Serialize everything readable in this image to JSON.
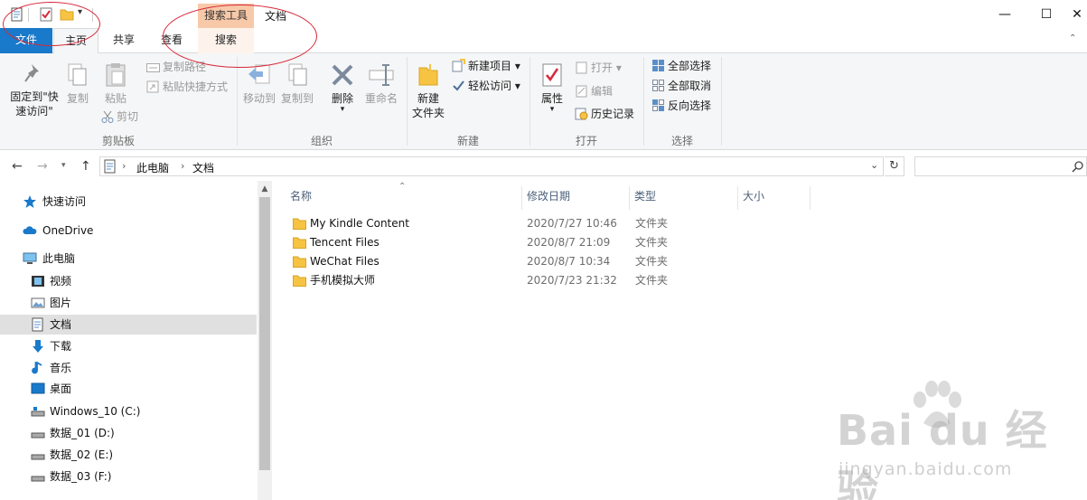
{
  "titlebar": {
    "context_tab_header": "搜索工具",
    "window_title": "文档",
    "quick_access_dropdown": "▾",
    "minimize": "—",
    "maximize": "☐",
    "close": "✕"
  },
  "tabs": {
    "file": "文件",
    "home": "主页",
    "share": "共享",
    "view": "查看",
    "search": "搜索"
  },
  "ribbon": {
    "clipboard": {
      "label": "剪贴板",
      "pin_line1": "固定到\"快",
      "pin_line2": "速访问\"",
      "copy": "复制",
      "paste": "粘贴",
      "copy_path": "复制路径",
      "paste_shortcut": "粘贴快捷方式",
      "cut": "剪切"
    },
    "organize": {
      "label": "组织",
      "move_to": "移动到",
      "copy_to": "复制到",
      "delete": "删除",
      "rename": "重命名"
    },
    "new": {
      "label": "新建",
      "new_folder_line1": "新建",
      "new_folder_line2": "文件夹",
      "new_item": "新建项目 ▾",
      "easy_access": "轻松访问 ▾"
    },
    "open": {
      "label": "打开",
      "properties": "属性",
      "open": "打开 ▾",
      "edit": "编辑",
      "history": "历史记录"
    },
    "select": {
      "label": "选择",
      "select_all": "全部选择",
      "select_none": "全部取消",
      "invert": "反向选择"
    }
  },
  "address": {
    "crumbs": [
      "此电脑",
      "文档"
    ],
    "search_placeholder": ""
  },
  "nav": {
    "items": [
      {
        "label": "快速访问",
        "icon": "star-icon"
      },
      {
        "label": "OneDrive",
        "icon": "cloud-icon"
      },
      {
        "label": "此电脑",
        "icon": "computer-icon"
      },
      {
        "label": "视频",
        "icon": "video-icon"
      },
      {
        "label": "图片",
        "icon": "picture-icon"
      },
      {
        "label": "文档",
        "icon": "document-icon"
      },
      {
        "label": "下载",
        "icon": "download-icon"
      },
      {
        "label": "音乐",
        "icon": "music-icon"
      },
      {
        "label": "桌面",
        "icon": "desktop-icon"
      },
      {
        "label": "Windows_10 (C:)",
        "icon": "system-drive-icon"
      },
      {
        "label": "数据_01 (D:)",
        "icon": "drive-icon"
      },
      {
        "label": "数据_02 (E:)",
        "icon": "drive-icon"
      },
      {
        "label": "数据_03 (F:)",
        "icon": "drive-icon"
      }
    ]
  },
  "files": {
    "columns": [
      "名称",
      "修改日期",
      "类型",
      "大小"
    ],
    "rows": [
      {
        "name": "My Kindle Content",
        "date": "2020/7/27 10:46",
        "type": "文件夹",
        "size": ""
      },
      {
        "name": "Tencent Files",
        "date": "2020/8/7 21:09",
        "type": "文件夹",
        "size": ""
      },
      {
        "name": "WeChat Files",
        "date": "2020/8/7 10:34",
        "type": "文件夹",
        "size": ""
      },
      {
        "name": "手机模拟大师",
        "date": "2020/7/23 21:32",
        "type": "文件夹",
        "size": ""
      }
    ]
  },
  "watermark": {
    "logo": "Bai du 经验",
    "url": "jingyan.baidu.com"
  },
  "colors": {
    "file_tab": "#1979ca",
    "context_tab": "#f8c9a8",
    "annotation": "#d8283a",
    "folder": "#f6c343"
  }
}
